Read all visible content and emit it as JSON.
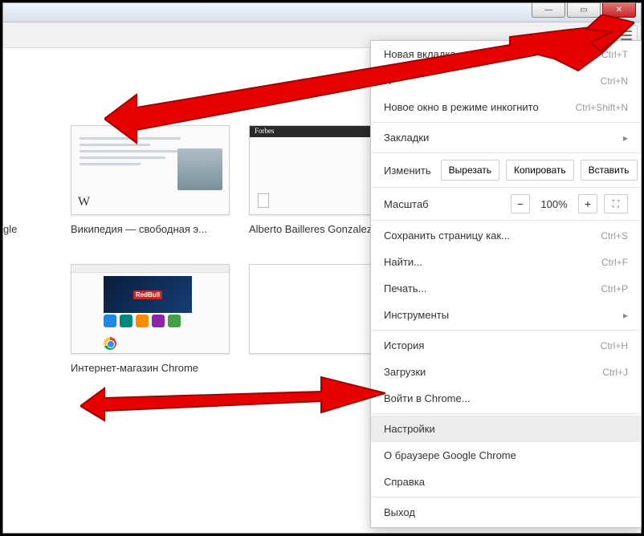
{
  "window": {
    "buttons": {
      "min": "—",
      "max": "▭",
      "close": "✕"
    }
  },
  "tiles_row1": [
    {
      "label": "gle",
      "thumb": "google"
    },
    {
      "label": "Википедия — свободная э...",
      "thumb": "wiki"
    },
    {
      "label": "Alberto Bailleres Gonzalez",
      "thumb": "forbes"
    }
  ],
  "tiles_row2": [
    {
      "label": "",
      "thumb": "blank"
    },
    {
      "label": "Интернет-магазин Chrome",
      "thumb": "store"
    },
    {
      "label": "",
      "thumb": "placeholder"
    }
  ],
  "menu": {
    "new_tab": {
      "label": "Новая вкладка",
      "shortcut": "Ctrl+T"
    },
    "new_window": {
      "label": "Н",
      "shortcut": "Ctrl+N"
    },
    "incognito": {
      "label": "Новое окно в режиме инкогнито",
      "shortcut": "Ctrl+Shift+N"
    },
    "bookmarks": {
      "label": "Закладки"
    },
    "edit": {
      "label": "Изменить",
      "cut": "Вырезать",
      "copy": "Копировать",
      "paste": "Вставить"
    },
    "zoom": {
      "label": "Масштаб",
      "value": "100%"
    },
    "save_as": {
      "label": "Сохранить страницу как...",
      "shortcut": "Ctrl+S"
    },
    "find": {
      "label": "Найти...",
      "shortcut": "Ctrl+F"
    },
    "print": {
      "label": "Печать...",
      "shortcut": "Ctrl+P"
    },
    "tools": {
      "label": "Инструменты"
    },
    "history": {
      "label": "История",
      "shortcut": "Ctrl+H"
    },
    "downloads": {
      "label": "Загрузки",
      "shortcut": "Ctrl+J"
    },
    "signin": {
      "label": "Войти в Chrome..."
    },
    "settings": {
      "label": "Настройки"
    },
    "about": {
      "label": "О браузере Google Chrome"
    },
    "help": {
      "label": "Справка"
    },
    "exit": {
      "label": "Выход"
    }
  }
}
